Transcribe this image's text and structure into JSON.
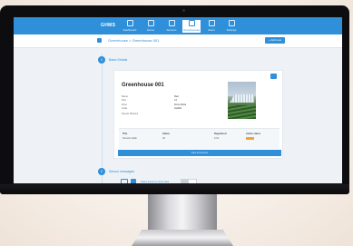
{
  "nav": {
    "logo": "GHMS",
    "items": [
      {
        "label": "Dashboard"
      },
      {
        "label": "Zones"
      },
      {
        "label": "Sensors"
      },
      {
        "label": "Greenhouses"
      },
      {
        "label": "Alerts"
      },
      {
        "label": "Settings"
      }
    ]
  },
  "breadcrumb": "Greenhouse > Greenhouse 001",
  "add_button": "+ Add new",
  "sections": {
    "basic_title": "Basic Details",
    "basic_step": "1",
    "sensor_title": "Sensor messages",
    "sensor_step": "2"
  },
  "greenhouse": {
    "name": "Greenhouse 001",
    "fields": [
      {
        "label": "Name",
        "value": "Red"
      },
      {
        "label": "Size",
        "value": "12"
      },
      {
        "label": "Zone",
        "value": "Zone Alpha"
      },
      {
        "label": "Code",
        "value": "GH001"
      },
      {
        "label": "Sensor Shelves",
        "value": ""
      }
    ]
  },
  "table": {
    "headers": [
      "Title",
      "Status",
      "Registered",
      "Active status"
    ],
    "row": [
      "Sensors table",
      "All",
      "Z-01",
      ""
    ]
  },
  "view_button": "View all sensors",
  "sensor_filter": "Select sensor to show data",
  "colors": {
    "accent": "#2f8fd8",
    "badge": "#f2a23a"
  }
}
